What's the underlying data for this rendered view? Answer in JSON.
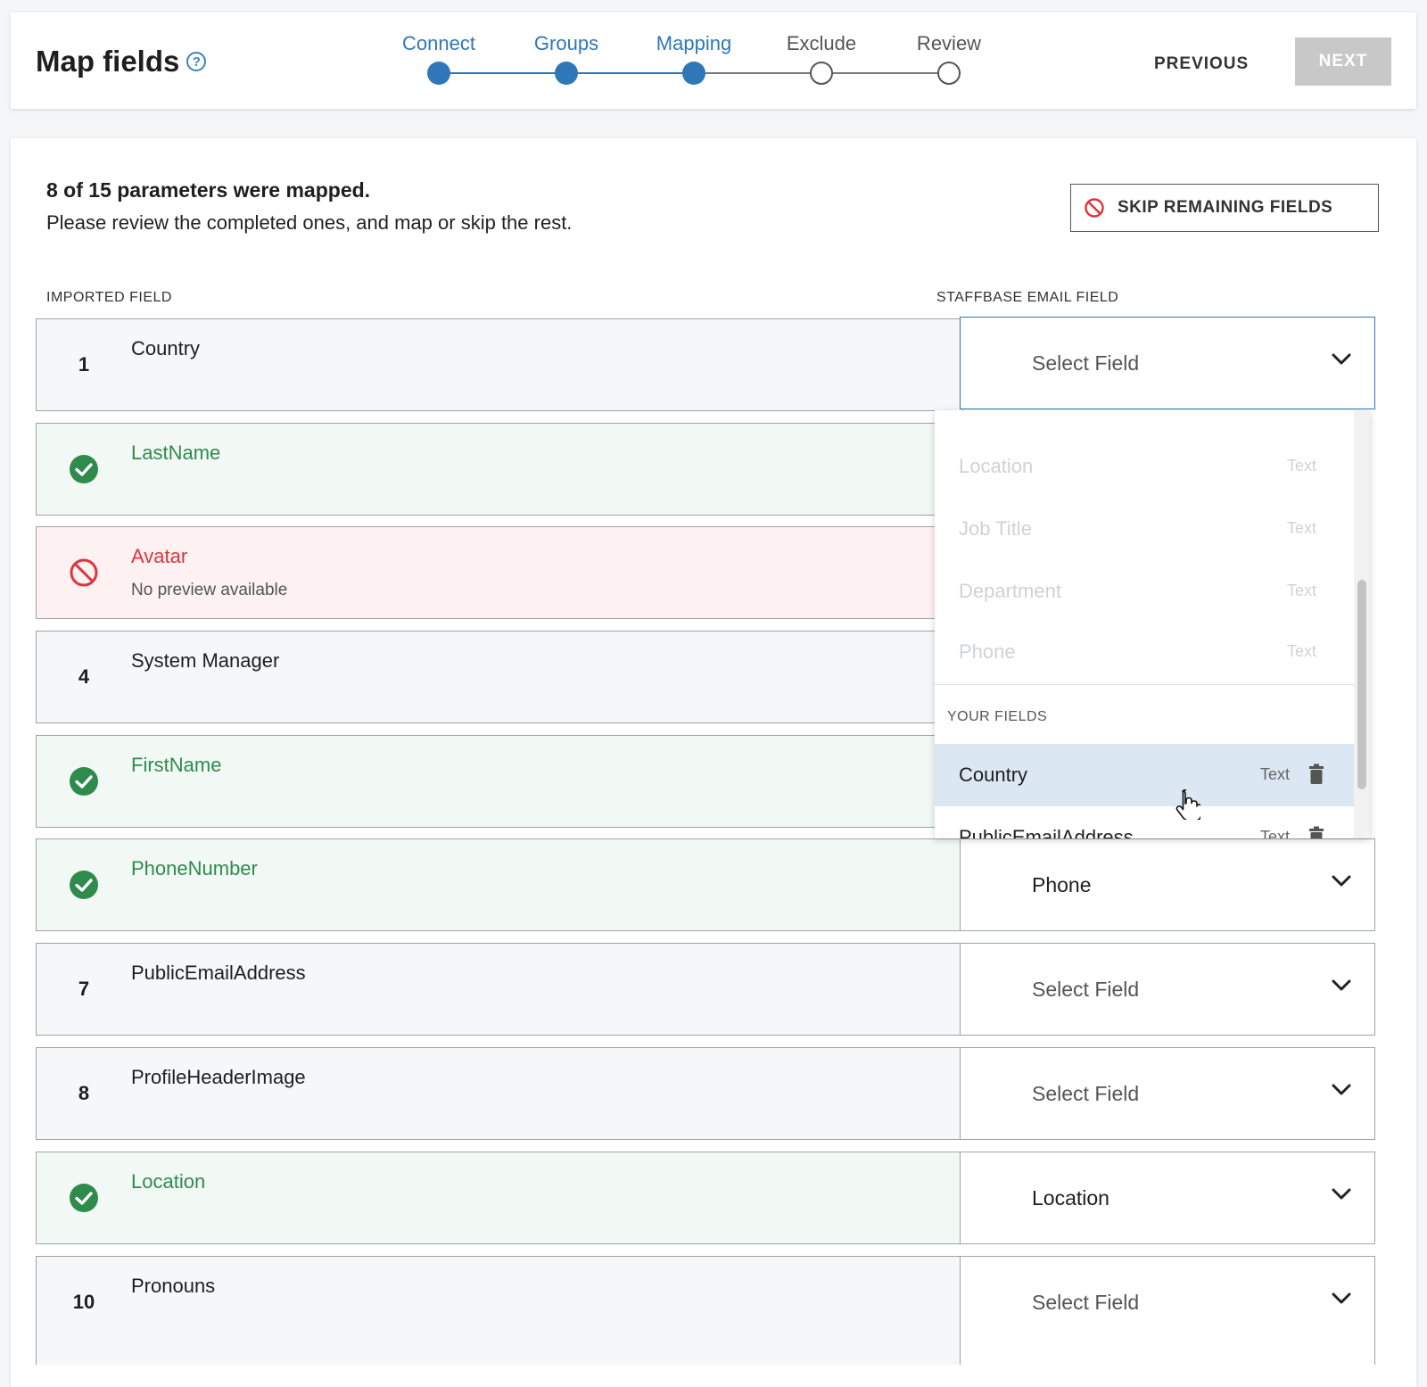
{
  "header": {
    "title": "Map fields",
    "help_icon": "help-circle-icon",
    "steps": [
      {
        "label": "Connect",
        "state": "done"
      },
      {
        "label": "Groups",
        "state": "done"
      },
      {
        "label": "Mapping",
        "state": "current"
      },
      {
        "label": "Exclude",
        "state": "todo"
      },
      {
        "label": "Review",
        "state": "todo"
      }
    ],
    "previous_label": "PREVIOUS",
    "next_label": "NEXT"
  },
  "summary": {
    "headline": "8 of 15 parameters were mapped.",
    "subtext": "Please review the completed ones, and map or skip the rest.",
    "skip_label": "SKIP REMAINING FIELDS"
  },
  "columns": {
    "imported": "IMPORTED FIELD",
    "staffbase": "STAFFBASE EMAIL FIELD"
  },
  "rows": [
    {
      "num": "1",
      "name": "Country",
      "status": "neutral",
      "mapped": "Select Field",
      "placeholder": true
    },
    {
      "num": "",
      "name": "LastName",
      "status": "ok",
      "mapped": "",
      "placeholder": false
    },
    {
      "num": "",
      "name": "Avatar",
      "status": "err",
      "preview": "No preview available",
      "mapped": "",
      "placeholder": false
    },
    {
      "num": "4",
      "name": "System Manager",
      "status": "neutral",
      "mapped": "",
      "placeholder": false
    },
    {
      "num": "",
      "name": "FirstName",
      "status": "ok",
      "mapped": "",
      "placeholder": false
    },
    {
      "num": "",
      "name": "PhoneNumber",
      "status": "ok",
      "mapped": "Phone",
      "placeholder": false
    },
    {
      "num": "7",
      "name": "PublicEmailAddress",
      "status": "neutral",
      "mapped": "Select Field",
      "placeholder": true
    },
    {
      "num": "8",
      "name": "ProfileHeaderImage",
      "status": "neutral",
      "mapped": "Select Field",
      "placeholder": true
    },
    {
      "num": "",
      "name": "Location",
      "status": "ok",
      "mapped": "Location",
      "placeholder": false
    },
    {
      "num": "10",
      "name": "Pronouns",
      "status": "neutral",
      "mapped": "Select Field",
      "placeholder": true
    }
  ],
  "dropdown": {
    "standard_items": [
      {
        "label": "Location",
        "type": "Text"
      },
      {
        "label": "Job Title",
        "type": "Text"
      },
      {
        "label": "Department",
        "type": "Text"
      },
      {
        "label": "Phone",
        "type": "Text"
      }
    ],
    "section_label": "YOUR FIELDS",
    "your_fields": [
      {
        "label": "Country",
        "type": "Text"
      },
      {
        "label": "PublicEmailAddress",
        "type": "Text"
      }
    ]
  },
  "colors": {
    "accent": "#2f77b8",
    "success": "#2e8b4c",
    "error": "#d9363e",
    "disabled_button": "#c8c8c8"
  }
}
